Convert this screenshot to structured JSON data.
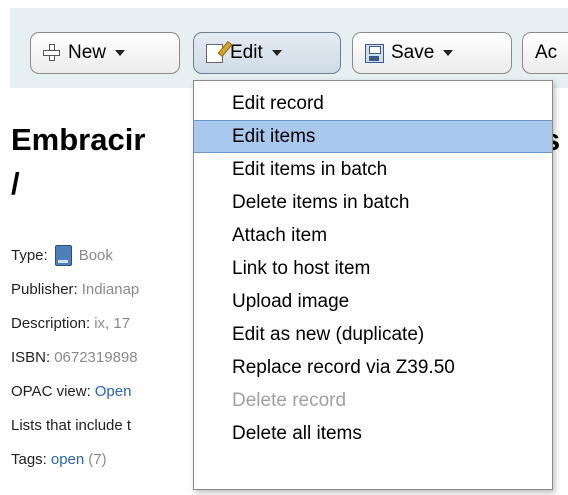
{
  "toolbar": {
    "new_label": "New",
    "edit_label": "Edit",
    "save_label": "Save",
    "next_label": "Ac"
  },
  "record": {
    "title": "Embracir",
    "title_tail": "s",
    "subtitle": "/",
    "details": [
      {
        "label": "Type:",
        "value": "Book",
        "icon": "book-icon"
      },
      {
        "label": "Publisher:",
        "value": "Indianap"
      },
      {
        "label": "Description:",
        "value": "ix, 17"
      },
      {
        "label": "ISBN:",
        "value": "0672319898"
      },
      {
        "label": "OPAC view:",
        "link": "Open"
      },
      {
        "label": "Lists that include t"
      },
      {
        "label": "Tags:",
        "link": "open",
        "count": "(7)"
      }
    ]
  },
  "edit_menu": {
    "items": [
      {
        "label": "Edit record"
      },
      {
        "label": "Edit items",
        "highlighted": true
      },
      {
        "label": "Edit items in batch"
      },
      {
        "label": "Delete items in batch"
      },
      {
        "label": "Attach item"
      },
      {
        "label": "Link to host item"
      },
      {
        "label": "Upload image"
      },
      {
        "label": "Edit as new (duplicate)"
      },
      {
        "label": "Replace record via Z39.50"
      },
      {
        "label": "Delete record",
        "disabled": true
      },
      {
        "label": "Delete all items"
      }
    ]
  },
  "colors": {
    "toolbar_bg": "#e6f0f2",
    "highlight": "#a9c8ee",
    "link": "#2a62b8"
  }
}
